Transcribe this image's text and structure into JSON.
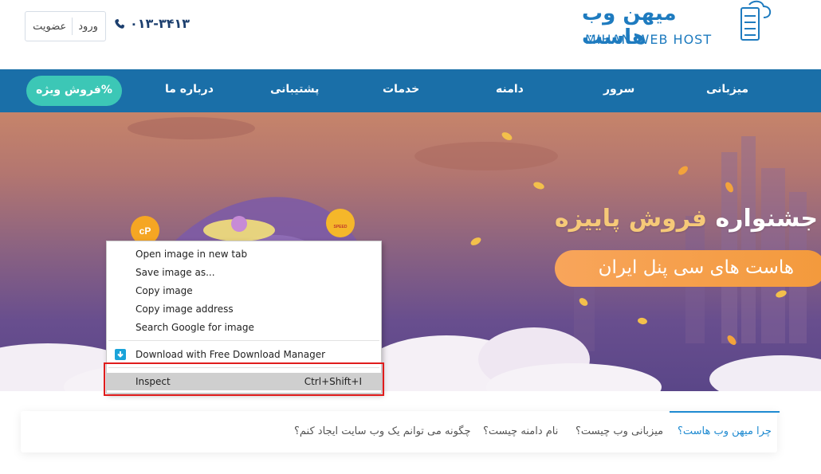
{
  "header": {
    "register_label": "عضویت",
    "login_label": "ورود",
    "phone": "۰۱۳-۳۴۱۳",
    "logo_fa": "میهن وب هاست",
    "logo_en": "MIHAN WEB HOST"
  },
  "nav": {
    "items": [
      "میزبانی",
      "سرور",
      "دامنه",
      "خدمات",
      "پشتیبانی",
      "درباره ما"
    ],
    "sale_label": "فروش ویژه%"
  },
  "banner": {
    "title_part1": "جشنواره ",
    "title_part2": "فروش پاییزه",
    "subtitle": "هاست های سی پنل ایران",
    "badge_left": "cP",
    "badge_right": "SPEED"
  },
  "context_menu": {
    "items": [
      "Open image in new tab",
      "Save image as...",
      "Copy image",
      "Copy image address",
      "Search Google for image",
      "Download with Free Download Manager",
      "Inspect"
    ],
    "inspect_shortcut": "Ctrl+Shift+I"
  },
  "tabs": {
    "items": [
      "چرا میهن وب هاست؟",
      "میزبانی وب چیست؟",
      "نام دامنه چیست؟",
      "چگونه می توانم یک وب سایت ایجاد کنم؟"
    ]
  },
  "colors": {
    "nav_bg": "#1a6fa8",
    "sale_button": "#3cc7b6",
    "accent_orange": "#f39a3c",
    "active_tab": "#1e8ad1",
    "highlight_box": "#e01c1c"
  }
}
